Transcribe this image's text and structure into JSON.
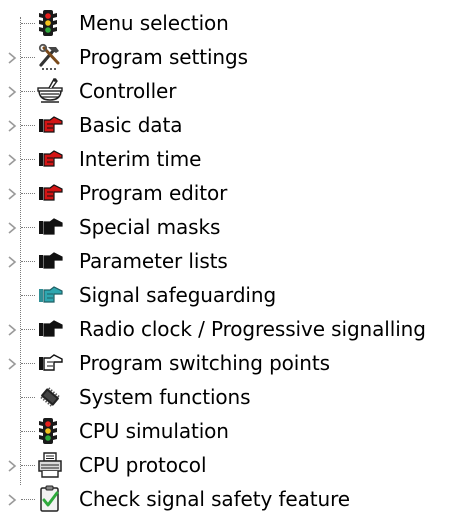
{
  "tree": {
    "items": [
      {
        "label": "Menu selection",
        "icon": "traffic-light-icon",
        "expandable": false
      },
      {
        "label": "Program settings",
        "icon": "tools-icon",
        "expandable": true
      },
      {
        "label": "Controller",
        "icon": "controller-cabinet-icon",
        "expandable": true
      },
      {
        "label": "Basic data",
        "icon": "red-pointing-hand-icon",
        "expandable": true
      },
      {
        "label": "Interim time",
        "icon": "red-pointing-hand-icon",
        "expandable": true
      },
      {
        "label": "Program editor",
        "icon": "red-pointing-hand-icon",
        "expandable": true
      },
      {
        "label": "Special masks",
        "icon": "black-pointing-hand-icon",
        "expandable": true
      },
      {
        "label": "Parameter lists",
        "icon": "black-pointing-hand-icon",
        "expandable": true
      },
      {
        "label": "Signal safeguarding",
        "icon": "teal-pointing-hand-icon",
        "expandable": false
      },
      {
        "label": "Radio clock / Progressive signalling",
        "icon": "black-pointing-hand-icon",
        "expandable": true
      },
      {
        "label": "Program switching points",
        "icon": "outline-pointing-hand-icon",
        "expandable": true
      },
      {
        "label": "System functions",
        "icon": "chip-icon",
        "expandable": false
      },
      {
        "label": "CPU simulation",
        "icon": "traffic-light-icon",
        "expandable": false
      },
      {
        "label": "CPU protocol",
        "icon": "printer-icon",
        "expandable": true
      },
      {
        "label": "Check signal safety feature",
        "icon": "clipboard-check-icon",
        "expandable": true
      }
    ]
  },
  "colors": {
    "red_hand": "#d31515",
    "teal_hand": "#2fa7b0",
    "black_hand": "#111111",
    "traffic_light_body": "#1a1a1a",
    "traffic_red": "#e8201c",
    "traffic_yellow": "#f4c21b",
    "traffic_green": "#2fa93c",
    "expander": "#9a9a9a",
    "connector": "#7a7a7a"
  }
}
